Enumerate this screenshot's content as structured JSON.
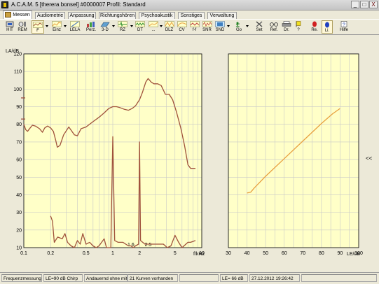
{
  "window": {
    "title": "A.C.A.M. 5 [therera bonsel] #0000007  Profil: Standard",
    "min_label": "_",
    "max_label": "□",
    "close_label": "X"
  },
  "tabs": [
    {
      "label": "Messen",
      "active": true
    },
    {
      "label": "Audiometrie"
    },
    {
      "label": "Anpassung"
    },
    {
      "label": "Richtungshören"
    },
    {
      "label": "Psychoakustik"
    },
    {
      "label": "Sonstiges"
    },
    {
      "label": "Verwaltung"
    }
  ],
  "toolbar": {
    "undo_label": "↶",
    "dot_label": "·",
    "buttons": [
      {
        "label": "HIT",
        "icon": "hit-icon"
      },
      {
        "label": "REM",
        "icon": "rem-icon"
      },
      {
        "label": "F",
        "icon": "f-curve-icon"
      },
      {
        "label": "Einz",
        "icon": "einz-curve-icon"
      },
      {
        "label": "LELA",
        "icon": "lela-icon"
      },
      {
        "label": "Perz.",
        "icon": "perz-icon"
      },
      {
        "label": "3-D",
        "icon": "3d-icon"
      },
      {
        "label": "RZ",
        "icon": "rz-icon"
      },
      {
        "label": "DT",
        "icon": "dt-icon"
      },
      {
        "label": "...",
        "icon": "more-icon"
      },
      {
        "label": "DLZ",
        "icon": "dlz-icon"
      },
      {
        "label": "CV",
        "icon": "cv-icon"
      },
      {
        "label": "f-f",
        "icon": "ff-icon"
      },
      {
        "label": "SNR",
        "icon": "snr-icon"
      },
      {
        "label": "SND",
        "icon": "snd-icon"
      },
      {
        "label": "Go",
        "icon": "go-icon"
      },
      {
        "label": "Set",
        "icon": "tools-icon"
      },
      {
        "label": "Ref.",
        "icon": "glasses-icon"
      },
      {
        "label": "Dr.",
        "icon": "printer-icon"
      },
      {
        "label": "?",
        "icon": "help-flag-icon"
      },
      {
        "label": "Re.",
        "icon": "right-ear-icon"
      },
      {
        "label": "Li.",
        "icon": "left-ear-icon"
      },
      {
        "label": "Hilfe",
        "icon": "help-icon"
      }
    ]
  },
  "colors": {
    "plot_bg": "#ffffc8",
    "grid": "#c8c8c8",
    "curve_brown": "#a0523c",
    "curve_orange": "#e8a040"
  },
  "chart_data": [
    {
      "type": "line",
      "xscale": "log",
      "xlim": [
        0.1,
        10
      ],
      "ylim": [
        10,
        120
      ],
      "ylabel": "LA/dB",
      "xlabel": "f/kHz",
      "x_ticks": [
        {
          "v": 0.1,
          "label": "0.1"
        },
        {
          "v": 0.2,
          "label": "0.2"
        },
        {
          "v": 0.5,
          "label": "0.5"
        },
        {
          "v": 1,
          "label": "1"
        },
        {
          "v": 2,
          "label": "2"
        },
        {
          "v": 5,
          "label": "5"
        },
        {
          "v": 10,
          "label": "10"
        }
      ],
      "x_minor_labels": [
        {
          "v": 1.6,
          "label": "1.6"
        },
        {
          "v": 2.5,
          "label": "2.5"
        }
      ],
      "y_ticks": [
        10,
        20,
        30,
        40,
        50,
        60,
        70,
        80,
        90,
        100,
        110,
        120
      ],
      "grid": true,
      "series": [
        {
          "color": "#a0523c",
          "points": [
            [
              0.1,
              80
            ],
            [
              0.105,
              77
            ],
            [
              0.11,
              76
            ],
            [
              0.118,
              78
            ],
            [
              0.125,
              79.5
            ],
            [
              0.135,
              79
            ],
            [
              0.15,
              77.5
            ],
            [
              0.162,
              75.5
            ],
            [
              0.172,
              78
            ],
            [
              0.185,
              79
            ],
            [
              0.2,
              78
            ],
            [
              0.215,
              76
            ],
            [
              0.228,
              71
            ],
            [
              0.238,
              67
            ],
            [
              0.255,
              68
            ],
            [
              0.28,
              74
            ],
            [
              0.32,
              78.5
            ],
            [
              0.37,
              74
            ],
            [
              0.4,
              73.5
            ],
            [
              0.44,
              77.5
            ],
            [
              0.5,
              78.5
            ],
            [
              0.6,
              81.5
            ],
            [
              0.7,
              84
            ],
            [
              0.8,
              86.5
            ],
            [
              0.9,
              89
            ],
            [
              1.0,
              90
            ],
            [
              1.1,
              90
            ],
            [
              1.2,
              89.5
            ],
            [
              1.35,
              88.5
            ],
            [
              1.5,
              88
            ],
            [
              1.65,
              89
            ],
            [
              1.8,
              90.5
            ],
            [
              2.0,
              94
            ],
            [
              2.15,
              98
            ],
            [
              2.35,
              104
            ],
            [
              2.5,
              106
            ],
            [
              2.7,
              104
            ],
            [
              2.9,
              103
            ],
            [
              3.2,
              103
            ],
            [
              3.5,
              102
            ],
            [
              3.9,
              97
            ],
            [
              4.3,
              97
            ],
            [
              4.7,
              94
            ],
            [
              5.2,
              87
            ],
            [
              5.8,
              78
            ],
            [
              6.4,
              68
            ],
            [
              7.0,
              57
            ],
            [
              7.5,
              55
            ],
            [
              8.5,
              55
            ]
          ]
        },
        {
          "color": "#a0523c",
          "points": [
            [
              0.2,
              28
            ],
            [
              0.21,
              25
            ],
            [
              0.22,
              13
            ],
            [
              0.24,
              16
            ],
            [
              0.27,
              15
            ],
            [
              0.29,
              18
            ],
            [
              0.31,
              13
            ],
            [
              0.34,
              11
            ],
            [
              0.37,
              10
            ],
            [
              0.4,
              14
            ],
            [
              0.43,
              12
            ],
            [
              0.46,
              18
            ],
            [
              0.5,
              12
            ],
            [
              0.55,
              13
            ],
            [
              0.6,
              11
            ],
            [
              0.65,
              10
            ],
            [
              0.7,
              11
            ],
            [
              0.8,
              15
            ],
            [
              0.85,
              10
            ],
            [
              0.95,
              10
            ],
            [
              1.0,
              73
            ],
            [
              1.05,
              14
            ],
            [
              1.15,
              13
            ],
            [
              1.3,
              13
            ],
            [
              1.5,
              11
            ],
            [
              1.6,
              11
            ],
            [
              1.7,
              10
            ],
            [
              1.8,
              11
            ],
            [
              1.95,
              12
            ],
            [
              2.0,
              70
            ],
            [
              2.05,
              14
            ],
            [
              2.3,
              12
            ],
            [
              2.7,
              12
            ],
            [
              3.2,
              12
            ],
            [
              3.7,
              12
            ],
            [
              4.1,
              10
            ],
            [
              4.5,
              11
            ],
            [
              5.0,
              17
            ],
            [
              5.5,
              13
            ],
            [
              6.0,
              10
            ],
            [
              7.0,
              13
            ],
            [
              7.5,
              13
            ],
            [
              8.5,
              14
            ]
          ]
        }
      ],
      "left_markers": [
        95,
        83
      ]
    },
    {
      "type": "line",
      "xlim": [
        30,
        100
      ],
      "ylim": [
        10,
        120
      ],
      "xlabel": "LE/dB",
      "x_ticks": [
        30,
        40,
        50,
        60,
        70,
        80,
        90,
        100
      ],
      "y_ticks": [
        10,
        20,
        30,
        40,
        50,
        60,
        70,
        80,
        90,
        100,
        110,
        120
      ],
      "grid": true,
      "series": [
        {
          "color": "#e8a040",
          "points": [
            [
              40,
              41
            ],
            [
              42,
              41.5
            ],
            [
              44,
              44
            ],
            [
              50,
              50.5
            ],
            [
              60,
              60.5
            ],
            [
              70,
              70.5
            ],
            [
              80,
              80.5
            ],
            [
              86,
              86
            ],
            [
              90,
              89
            ]
          ]
        }
      ]
    }
  ],
  "side": {
    "collapse_label": "<<"
  },
  "status": [
    {
      "text": "Frequenzmessung"
    },
    {
      "text": "LE=90 dB Chirp"
    },
    {
      "text": "Andauernd ohne mitte"
    },
    {
      "text": "21 Kurven vorhanden"
    },
    {
      "text": ""
    },
    {
      "text": "LE= 66 dB"
    },
    {
      "text": "27.12.2012 19:26:42"
    },
    {
      "text": ""
    }
  ]
}
